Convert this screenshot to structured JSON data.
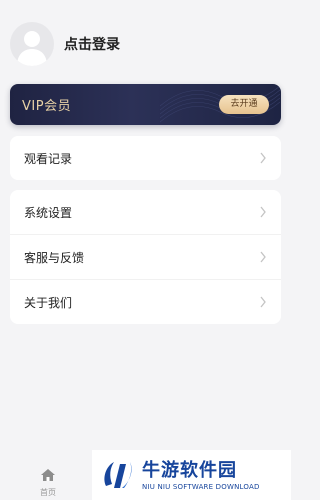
{
  "profile": {
    "login_label": "点击登录"
  },
  "vip": {
    "title": "VIP会员",
    "cta": "去开通"
  },
  "menu": {
    "history": "观看记录",
    "settings": "系统设置",
    "support": "客服与反馈",
    "about": "关于我们"
  },
  "tabbar": {
    "home": "首页"
  },
  "watermark": {
    "cn": "牛游软件园",
    "en": "NIU NIU SOFTWARE DOWNLOAD"
  },
  "colors": {
    "vip_bg": "#232849",
    "vip_gold": "#e8d2a6",
    "brand_blue": "#17459c"
  }
}
